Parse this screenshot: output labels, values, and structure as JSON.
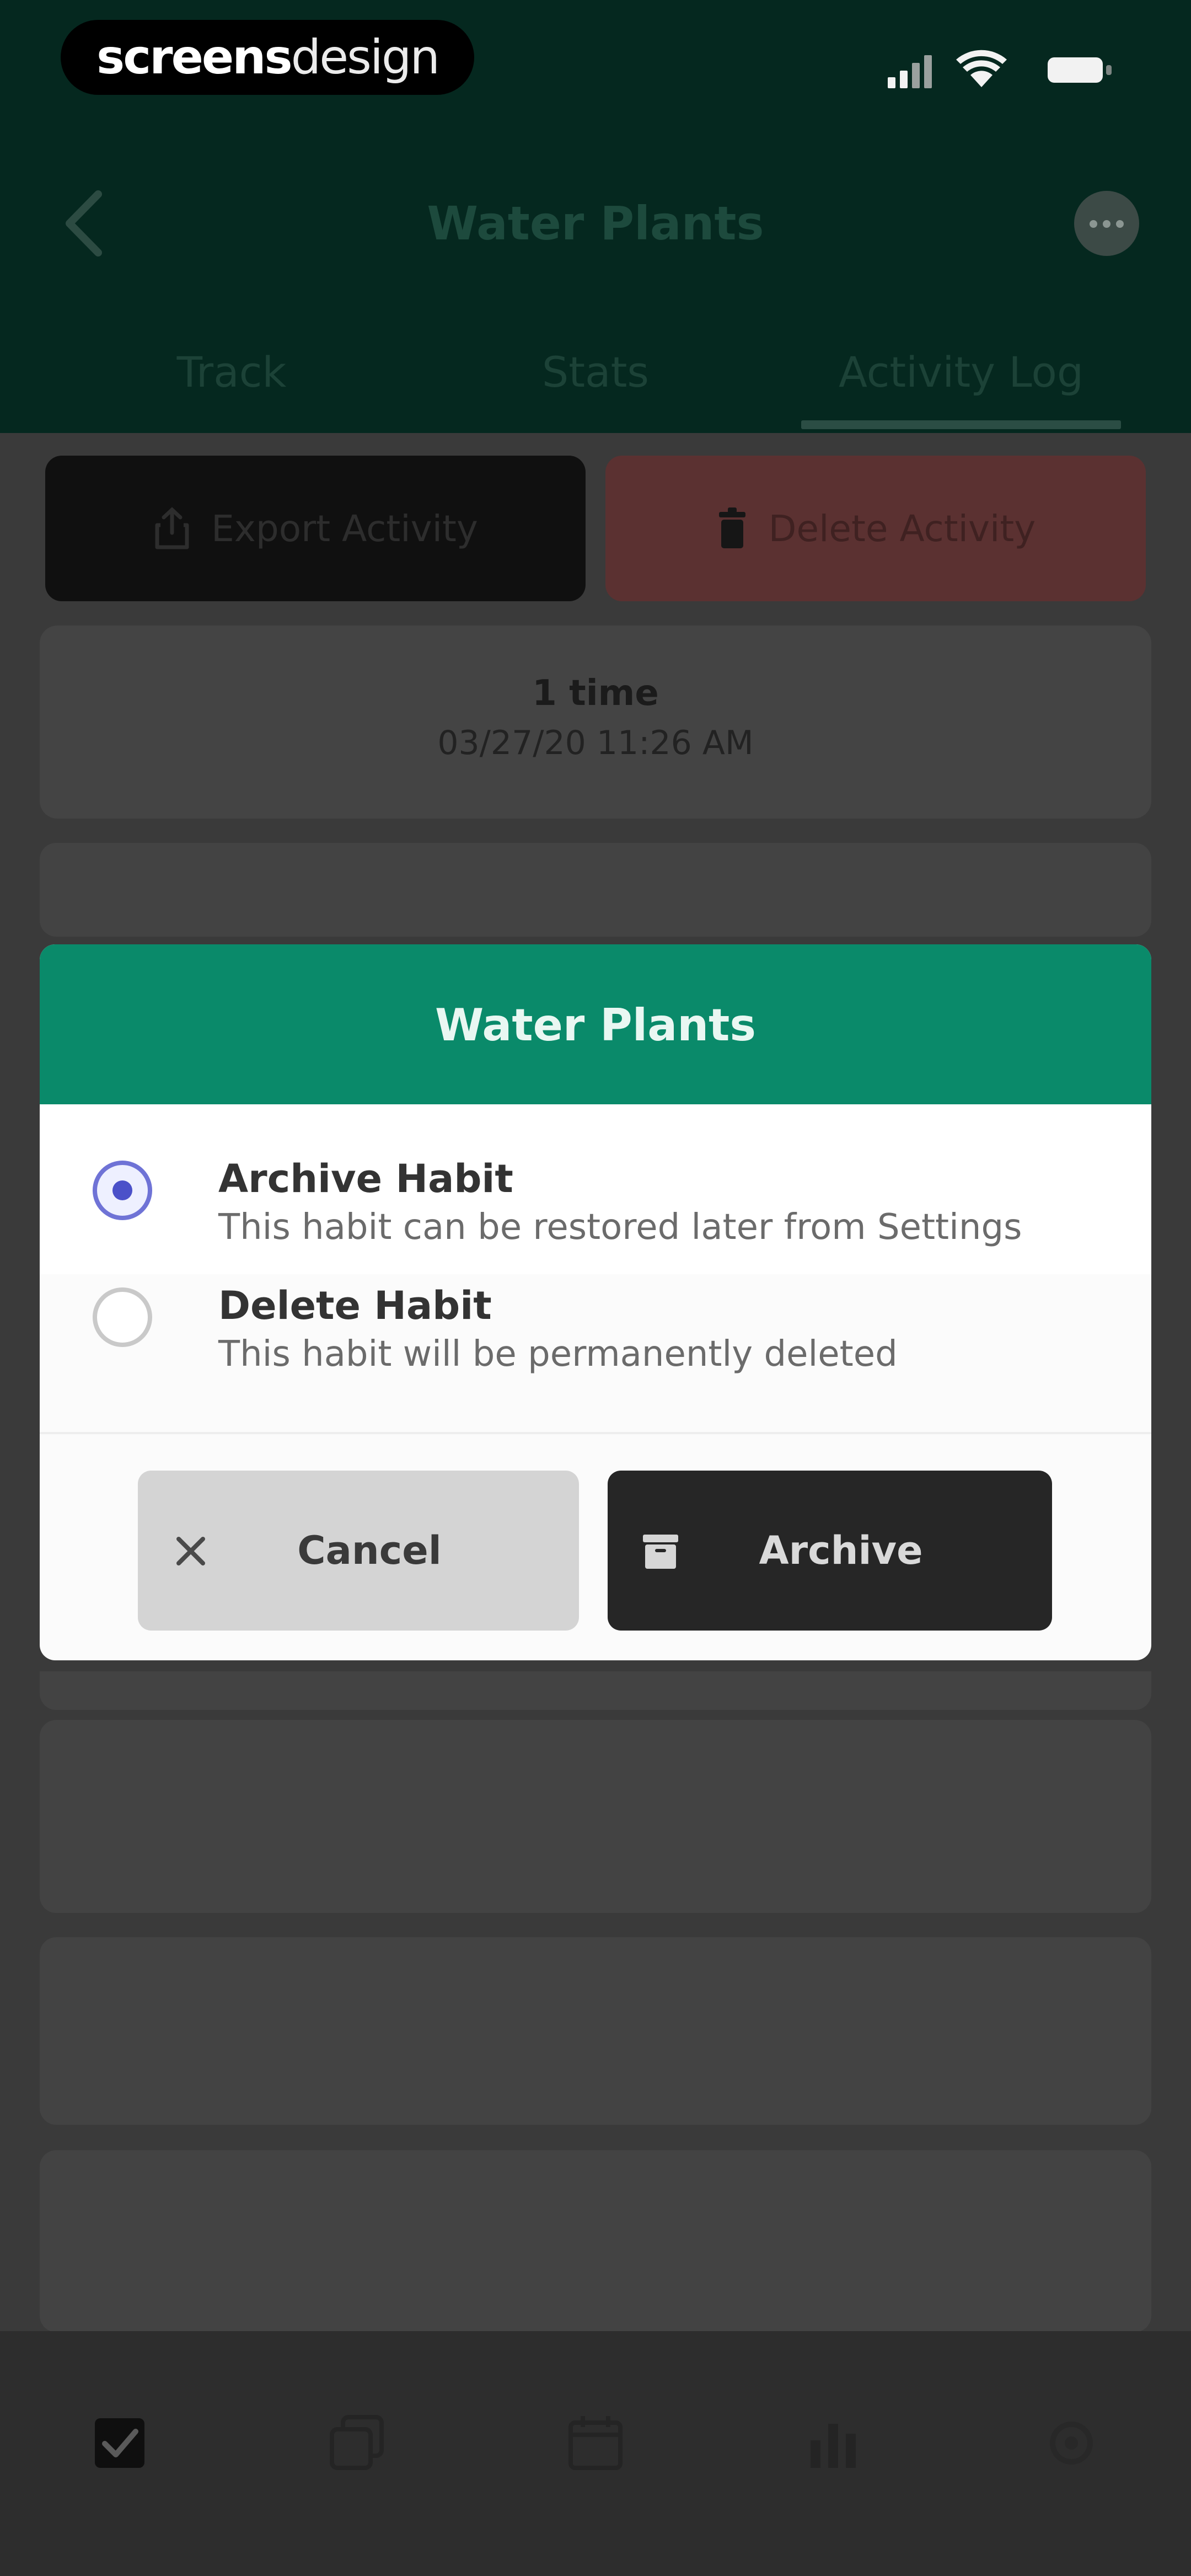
{
  "status_bar": {
    "brand_bold": "screens",
    "brand_light": "design",
    "signal_icon": "cellular-signal-icon",
    "wifi_icon": "wifi-icon",
    "battery_icon": "battery-icon"
  },
  "nav": {
    "title": "Water Plants",
    "back_icon": "chevron-left-icon",
    "more_icon": "more-dots-icon"
  },
  "tabs": [
    {
      "label": "Track",
      "active": false
    },
    {
      "label": "Stats",
      "active": false
    },
    {
      "label": "Activity Log",
      "active": true
    }
  ],
  "actions": {
    "export_label": "Export Activity",
    "export_icon": "share-icon",
    "delete_label": "Delete Activity",
    "delete_icon": "trash-icon"
  },
  "entries": [
    {
      "count": "1 time",
      "timestamp": "03/27/20 11:26 AM"
    }
  ],
  "dialog": {
    "title": "Water Plants",
    "options": [
      {
        "title": "Archive Habit",
        "description": "This habit can be restored later from Settings",
        "selected": true
      },
      {
        "title": "Delete Habit",
        "description": "This habit will be permanently deleted",
        "selected": false
      }
    ],
    "cancel_label": "Cancel",
    "cancel_icon": "close-icon",
    "archive_label": "Archive",
    "archive_icon": "archive-box-icon"
  },
  "tab_bar": [
    {
      "icon": "checkbox-icon",
      "active": true
    },
    {
      "icon": "stacked-cards-icon",
      "active": false
    },
    {
      "icon": "calendar-icon",
      "active": false
    },
    {
      "icon": "bar-chart-icon",
      "active": false
    },
    {
      "icon": "settings-icon",
      "active": false
    }
  ],
  "colors": {
    "header_bg": "#05281f",
    "dialog_header": "#0a8a6a",
    "radio_accent": "#4b51c9",
    "archive_button": "#262626",
    "cancel_button": "#d4d4d4"
  }
}
